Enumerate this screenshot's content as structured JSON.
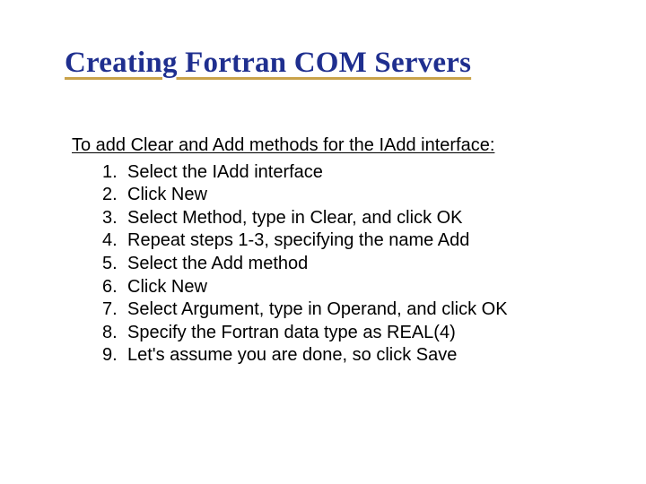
{
  "title": "Creating Fortran COM Servers",
  "intro": "To add Clear and Add methods for the IAdd interface:",
  "steps": [
    "Select the IAdd interface",
    "Click New",
    "Select Method, type in Clear, and click OK",
    "Repeat steps 1-3, specifying the name Add",
    "Select the Add method",
    "Click New",
    "Select Argument, type in Operand, and click OK",
    "Specify the Fortran data type as REAL(4)",
    "Let's assume you are done, so click Save"
  ]
}
